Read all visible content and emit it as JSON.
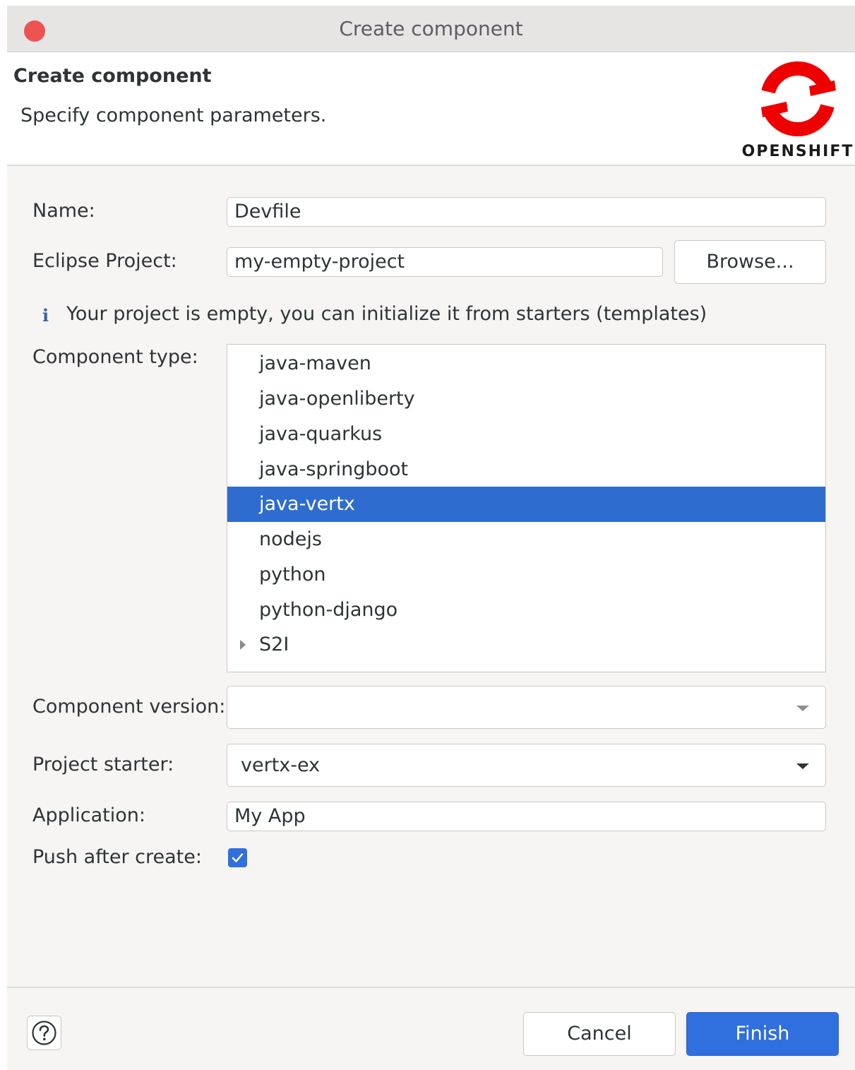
{
  "window": {
    "title": "Create component"
  },
  "banner": {
    "title": "Create component",
    "description": "Specify component parameters.",
    "logo_text": "OPENSHIFT",
    "brand_color": "#ee0000"
  },
  "form": {
    "name": {
      "label": "Name:",
      "value": "Devfile"
    },
    "project": {
      "label": "Eclipse Project:",
      "value": "my-empty-project",
      "browse_label": "Browse..."
    },
    "info": {
      "icon": "info-icon",
      "text": "Your project is empty, you can initialize it from starters (templates)"
    },
    "component_type": {
      "label": "Component type:",
      "items": [
        "java-maven",
        "java-openliberty",
        "java-quarkus",
        "java-springboot",
        "java-vertx",
        "nodejs",
        "python",
        "python-django",
        "S2I"
      ],
      "selected": "java-vertx",
      "expandable": "S2I"
    },
    "component_version": {
      "label": "Component version:",
      "value": ""
    },
    "project_starter": {
      "label": "Project starter:",
      "value": "vertx-ex"
    },
    "application": {
      "label": "Application:",
      "value": "My App"
    },
    "push": {
      "label": "Push after create:",
      "checked": true
    }
  },
  "footer": {
    "cancel_label": "Cancel",
    "finish_label": "Finish"
  },
  "colors": {
    "selection": "#2f6ccf",
    "primary": "#2f6fde",
    "close": "#ed5353"
  }
}
